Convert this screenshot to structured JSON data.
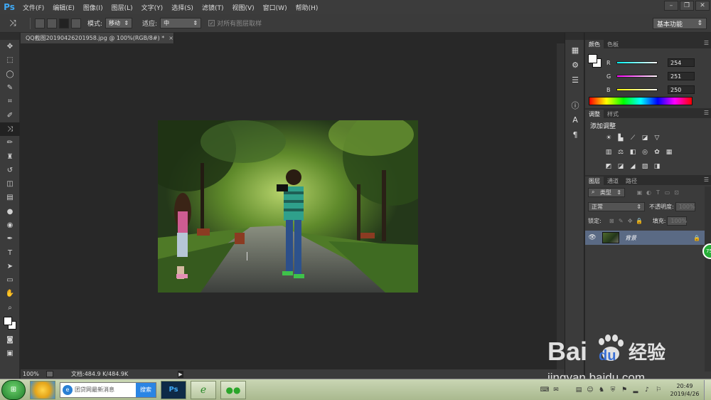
{
  "app": {
    "logo": "Ps"
  },
  "menu": [
    "文件(F)",
    "编辑(E)",
    "图像(I)",
    "图层(L)",
    "文字(Y)",
    "选择(S)",
    "滤镜(T)",
    "视图(V)",
    "窗口(W)",
    "帮助(H)"
  ],
  "window_controls": {
    "minimize": "–",
    "restore": "❐",
    "close": "✕"
  },
  "options": {
    "tool_icon": "content-aware-move-icon",
    "tool_glyph": "⤨",
    "mode_label": "模式:",
    "mode_value": "移动",
    "adapt_label": "适应:",
    "adapt_value": "中",
    "sample_all_layers": "对所有图层取样",
    "workspace": "基本功能"
  },
  "tools": [
    {
      "name": "move-tool-icon",
      "glyph": "✥"
    },
    {
      "name": "marquee-tool-icon",
      "glyph": "⬚"
    },
    {
      "name": "lasso-tool-icon",
      "glyph": "◯"
    },
    {
      "name": "quick-selection-tool-icon",
      "glyph": "✎"
    },
    {
      "name": "crop-tool-icon",
      "glyph": "⌗"
    },
    {
      "name": "eyedropper-tool-icon",
      "glyph": "✐"
    },
    {
      "name": "content-aware-move-tool-icon",
      "glyph": "⤨"
    },
    {
      "name": "brush-tool-icon",
      "glyph": "✏"
    },
    {
      "name": "clone-stamp-tool-icon",
      "glyph": "♜"
    },
    {
      "name": "history-brush-tool-icon",
      "glyph": "↺"
    },
    {
      "name": "eraser-tool-icon",
      "glyph": "◫"
    },
    {
      "name": "gradient-tool-icon",
      "glyph": "▤"
    },
    {
      "name": "blur-tool-icon",
      "glyph": "●"
    },
    {
      "name": "dodge-tool-icon",
      "glyph": "◉"
    },
    {
      "name": "pen-tool-icon",
      "glyph": "✒"
    },
    {
      "name": "type-tool-icon",
      "glyph": "T"
    },
    {
      "name": "path-selection-tool-icon",
      "glyph": "➤"
    },
    {
      "name": "rectangle-tool-icon",
      "glyph": "▭"
    },
    {
      "name": "hand-tool-icon",
      "glyph": "✋"
    },
    {
      "name": "zoom-tool-icon",
      "glyph": "⌕"
    }
  ],
  "bottom_tools": [
    {
      "name": "quick-mask-icon",
      "glyph": "◙"
    },
    {
      "name": "screen-mode-icon",
      "glyph": "▣"
    }
  ],
  "document": {
    "tab_title": "QQ截图20190426201958.jpg @ 100%(RGB/8#) *",
    "close": "×"
  },
  "status": {
    "zoom": "100%",
    "doc_info": "文档:484.9 K/484.9K",
    "arrow": "▶"
  },
  "dock_icons": [
    {
      "name": "history-icon",
      "glyph": "▦"
    },
    {
      "name": "actions-icon",
      "glyph": "⚙"
    },
    {
      "name": "properties-icon",
      "glyph": "☰"
    },
    {
      "name": "info-icon",
      "glyph": "ⓘ"
    },
    {
      "name": "character-icon",
      "glyph": "A"
    },
    {
      "name": "paragraph-icon",
      "glyph": "¶"
    }
  ],
  "color_panel": {
    "tabs": [
      "颜色",
      "色板"
    ],
    "sliders": [
      {
        "label": "R",
        "value": "254",
        "gradient": "linear-gradient(to right,#00fbfa,#fefbfa)"
      },
      {
        "label": "G",
        "value": "251",
        "gradient": "linear-gradient(to right,#fe00fa,#fefbfa)"
      },
      {
        "label": "B",
        "value": "250",
        "gradient": "linear-gradient(to right,#fefb00,#fefbfa)"
      }
    ]
  },
  "adjust_panel": {
    "tabs": [
      "调整",
      "样式"
    ],
    "title": "添加调整",
    "rows": [
      [
        {
          "name": "brightness-contrast-icon",
          "glyph": "☀"
        },
        {
          "name": "levels-icon",
          "glyph": "▙"
        },
        {
          "name": "curves-icon",
          "glyph": "⟋"
        },
        {
          "name": "exposure-icon",
          "glyph": "◪"
        },
        {
          "name": "vibrance-icon",
          "glyph": "▽"
        }
      ],
      [
        {
          "name": "hue-saturation-icon",
          "glyph": "▥"
        },
        {
          "name": "color-balance-icon",
          "glyph": "⚖"
        },
        {
          "name": "black-white-icon",
          "glyph": "◧"
        },
        {
          "name": "photo-filter-icon",
          "glyph": "◎"
        },
        {
          "name": "channel-mixer-icon",
          "glyph": "✿"
        },
        {
          "name": "color-lookup-icon",
          "glyph": "▦"
        }
      ],
      [
        {
          "name": "invert-icon",
          "glyph": "◩"
        },
        {
          "name": "posterize-icon",
          "glyph": "◪"
        },
        {
          "name": "threshold-icon",
          "glyph": "◢"
        },
        {
          "name": "gradient-map-icon",
          "glyph": "▧"
        },
        {
          "name": "selective-color-icon",
          "glyph": "◨"
        }
      ]
    ]
  },
  "layers_panel": {
    "tabs": [
      "图层",
      "通道",
      "路径"
    ],
    "filter_label": "类型",
    "blend_mode": "正常",
    "opacity_label": "不透明度:",
    "opacity_value": "100%",
    "lock_label": "锁定:",
    "fill_label": "填充:",
    "fill_value": "100%",
    "layer_name": "背景",
    "eye": "👁",
    "lock_icon": "🔒",
    "badge": "75"
  },
  "watermark": {
    "brand": "Bai",
    "brand2": "du",
    "brand_cn": "经验",
    "url": "jingyan.baidu.com"
  },
  "taskbar": {
    "start": "⊞",
    "search_text": "团贷网最新消息",
    "search_button": "搜索",
    "ps_label": "Ps",
    "time": "20:49",
    "date": "2019/4/26"
  }
}
